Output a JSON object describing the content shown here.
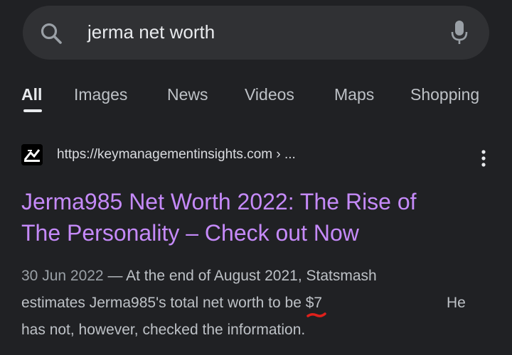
{
  "search": {
    "query": "jerma net worth"
  },
  "tabs": [
    {
      "label": "All",
      "active": true
    },
    {
      "label": "Images",
      "active": false
    },
    {
      "label": "News",
      "active": false
    },
    {
      "label": "Videos",
      "active": false
    },
    {
      "label": "Maps",
      "active": false
    },
    {
      "label": "Shopping",
      "active": false
    }
  ],
  "result": {
    "url": "https://keymanagementinsights.com › ...",
    "title_lines": [
      "Jerma985 Net Worth 2022: The Rise of",
      "The Personality – Check out Now"
    ],
    "snippet": {
      "date": "30 Jun 2022",
      "separator": " — ",
      "line1_text": "At the end of August 2021, Statsmash",
      "line2_text": "estimates Jerma985's total net worth to be ",
      "amount": "$7",
      "line2_trailing": "He",
      "line3_text": "has not, however, checked the information."
    }
  },
  "colors": {
    "background": "#202124",
    "search_bar": "#303134",
    "title_link": "#c58af9",
    "annotation_mark": "#e0201b"
  },
  "icons": {
    "search": "search-icon",
    "mic": "mic-icon",
    "more": "more-vert-icon",
    "favicon": "site-favicon"
  }
}
